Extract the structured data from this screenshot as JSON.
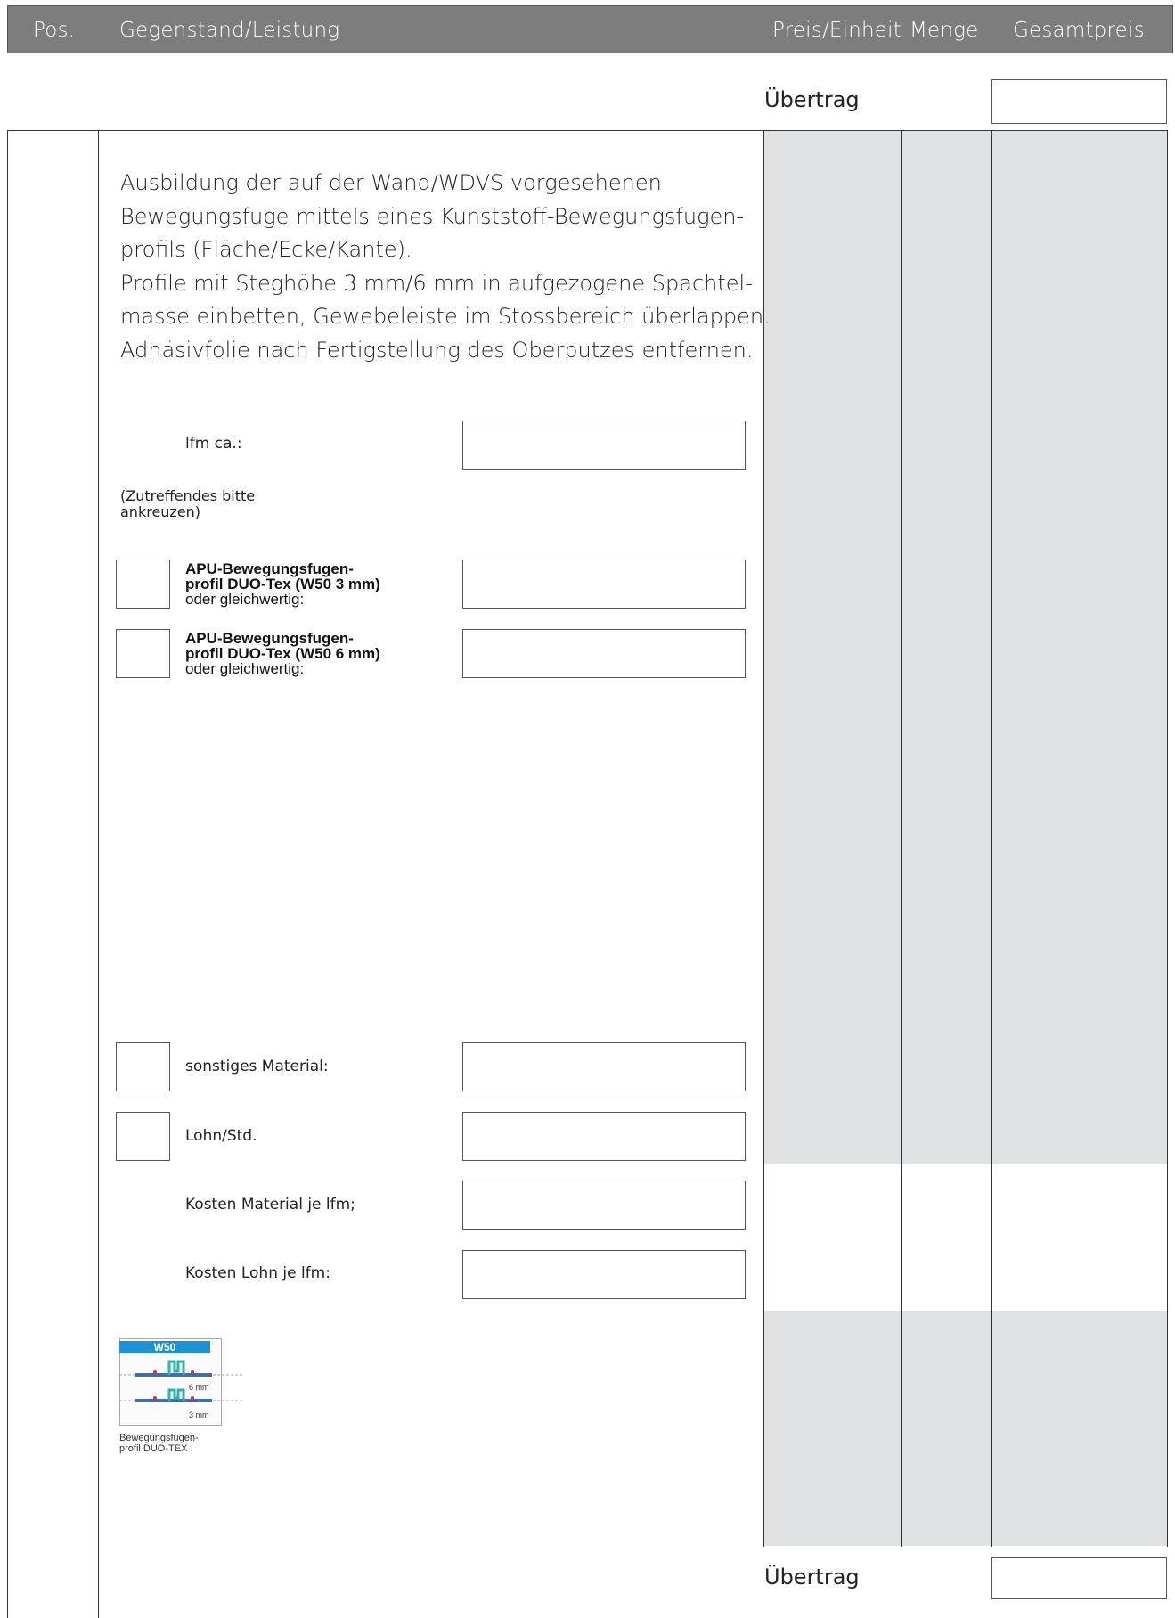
{
  "header": {
    "pos": "Pos.",
    "item": "Gegenstand/Leistung",
    "unit_price": "Preis/Einheit",
    "quantity": "Menge",
    "total": "Gesamtpreis"
  },
  "carry_over_top": "Übertrag",
  "carry_over_bottom": "Übertrag",
  "description": [
    "Ausbildung der auf der Wand/WDVS vorgesehenen",
    "Bewegungsfuge mittels eines Kunststoff-Bewegungsfugen-",
    "profils (Fläche/Ecke/Kante).",
    "Profile mit Steghöhe 3 mm/6 mm in aufgezogene Spachtel-",
    "masse einbetten, Gewebeleiste im Stossbereich überlappen.",
    "Adhäsivfolie nach Fertigstellung des Oberputzes entfernen."
  ],
  "fields": {
    "lfm_label": "lfm ca.:",
    "hint_line1": "(Zutreffendes bitte",
    "hint_line2": "ankreuzen)",
    "option1": {
      "bold1": "APU-Bewegungsfugen-",
      "bold2": "profil DUO-Tex (W50 3 mm)",
      "normal": "oder gleichwertig:"
    },
    "option2": {
      "bold1": "APU-Bewegungsfugen-",
      "bold2": "profil DUO-Tex (W50 6 mm)",
      "normal": "oder gleichwertig:"
    },
    "other_material": "sonstiges Material:",
    "wage": "Lohn/Std.",
    "cost_material": "Kosten Material je lfm;",
    "cost_wage": "Kosten Lohn je lfm:"
  },
  "figure": {
    "badge": "W50",
    "size_top": "6 mm",
    "size_bottom": "3 mm",
    "caption1": "Bewegungsfugen-",
    "caption2": "profil DUO-TEX",
    "accent_color": "#1e90d6",
    "profile_color": "#2ab5a8",
    "mark_color": "#e03030"
  },
  "colors": {
    "header_bg": "#7d7d7d",
    "shade": "#e0e1e3"
  }
}
